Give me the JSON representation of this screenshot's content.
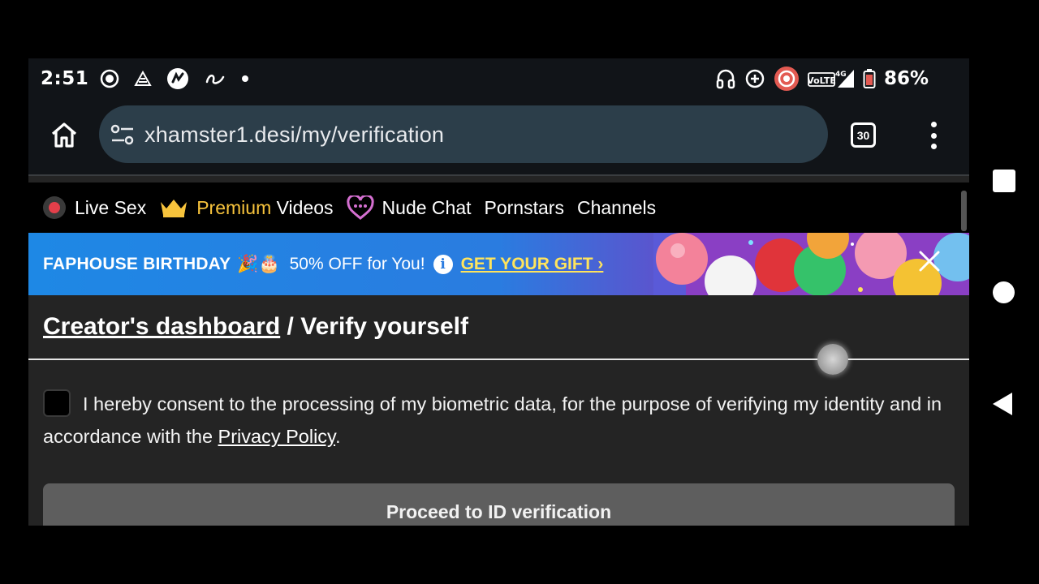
{
  "status_bar": {
    "time": "2:51",
    "network": "VoLTE 4G",
    "battery_percent": "86%",
    "icons": [
      "record-icon",
      "signal-app-icon",
      "app-icon",
      "app-icon-2",
      "dot-icon",
      "headphones-icon",
      "data-saver-icon",
      "screen-record-icon",
      "network-icon",
      "battery-icon"
    ]
  },
  "browser": {
    "url": "xhamster1.desi/my/verification",
    "tab_count": "30"
  },
  "site_nav": {
    "items": [
      {
        "label": "Live Sex",
        "icon": "live-dot-icon"
      },
      {
        "label_highlight": "Premium",
        "label": "Videos",
        "icon": "crown-icon"
      },
      {
        "label": "Nude Chat",
        "icon": "chat-heart-icon"
      },
      {
        "label": "Pornstars"
      },
      {
        "label": "Channels"
      }
    ]
  },
  "promo": {
    "title": "FAPHOUSE BIRTHDAY",
    "emojis": "🎉🎂",
    "offer": "50% OFF for You!",
    "cta": "GET YOUR GIFT",
    "cta_arrow": "›",
    "colors": {
      "start": "#1e88e5",
      "end": "#8a3fc4",
      "cta": "#ffe45c"
    }
  },
  "page": {
    "breadcrumb_link": "Creator's dashboard",
    "breadcrumb_separator": " / ",
    "breadcrumb_current": "Verify yourself",
    "consent_text": "I hereby consent to the processing of my biometric data, for the purpose of verifying my identity and in accordance with the ",
    "privacy_link": "Privacy Policy",
    "consent_end": ".",
    "consent_checked": false,
    "proceed_button": "Proceed to ID verification"
  },
  "android_nav": [
    "recents-button",
    "home-button",
    "back-button"
  ]
}
